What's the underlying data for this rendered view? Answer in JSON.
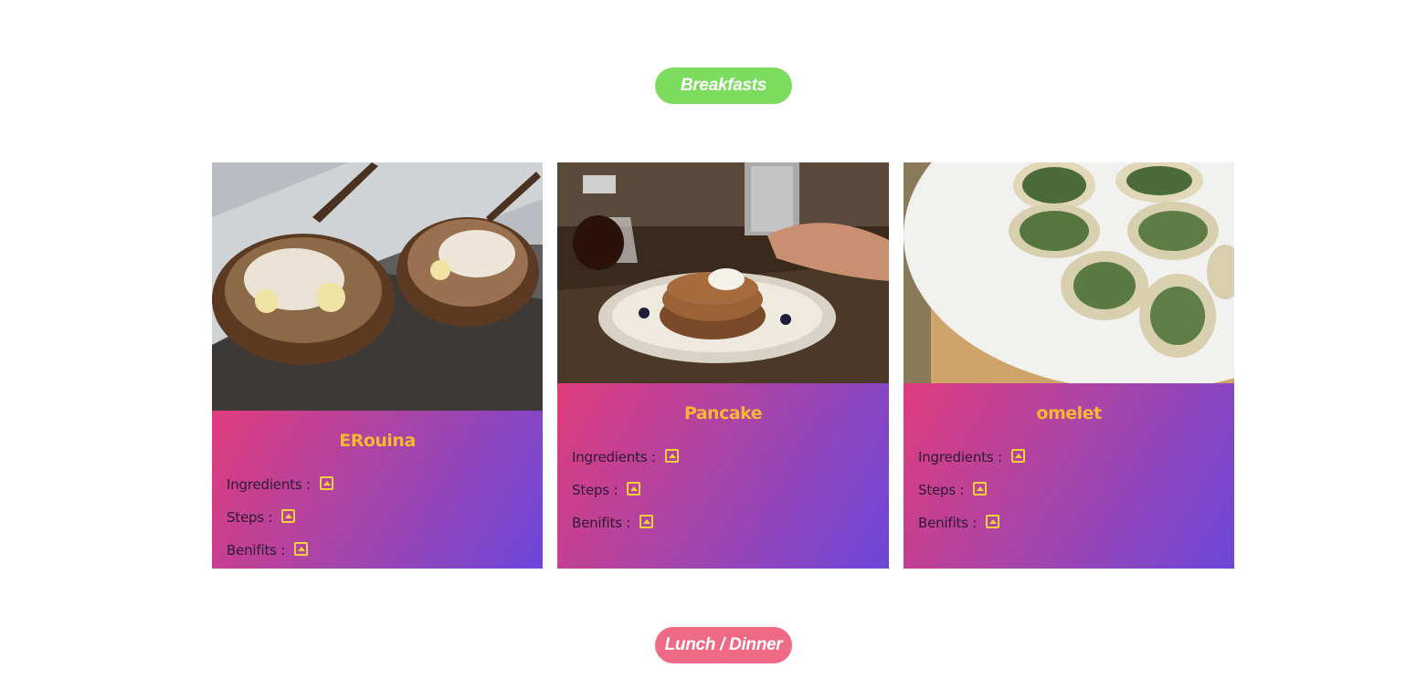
{
  "sections": {
    "breakfast_label": "Breakfasts",
    "lunch_label": "Lunch / Dinner"
  },
  "recipes": [
    {
      "name": "ERouina",
      "image": "erouina-bowls-photo",
      "ingredients_label": "Ingredients :",
      "steps_label": "Steps :",
      "benefits_label": "Benifits :"
    },
    {
      "name": "Pancake",
      "image": "pancake-stack-photo",
      "ingredients_label": "Ingredients :",
      "steps_label": "Steps :",
      "benefits_label": "Benifits :"
    },
    {
      "name": "omelet",
      "image": "baked-oysters-photo",
      "ingredients_label": "Ingredients :",
      "steps_label": "Steps :",
      "benefits_label": "Benifits :"
    }
  ],
  "colors": {
    "breakfast_pill": "#7bdc5d",
    "lunch_pill": "#ef6a84",
    "card_gradient_start": "#e03c7c",
    "card_gradient_end": "#6c46da",
    "recipe_title": "#f7b733",
    "toggle_icon": "#f2d23a"
  },
  "icons": {
    "toggle": "expand-up-icon"
  }
}
